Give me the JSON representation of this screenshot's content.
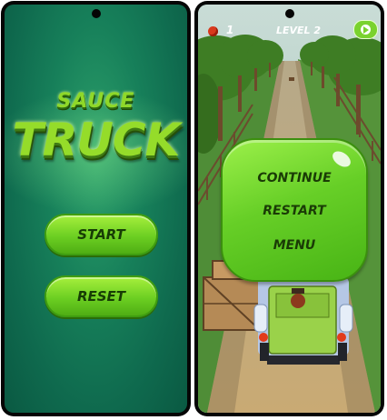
{
  "left_screen": {
    "logo_line1": "SAUCE",
    "logo_line2": "TRUCK",
    "start_label": "START",
    "reset_label": "RESET"
  },
  "right_screen": {
    "hud": {
      "lives": "1",
      "level": "LEVEL 2",
      "lives_icon": "tomato-icon",
      "pause_icon": "play-icon"
    },
    "pause_menu": {
      "continue_label": "CONTINUE",
      "restart_label": "RESTART",
      "menu_label": "MENU"
    }
  },
  "colors": {
    "button_green": "#6ccf22",
    "button_text": "#173d05",
    "background_teal": "#17805a",
    "logo_green": "#95dc2a"
  }
}
